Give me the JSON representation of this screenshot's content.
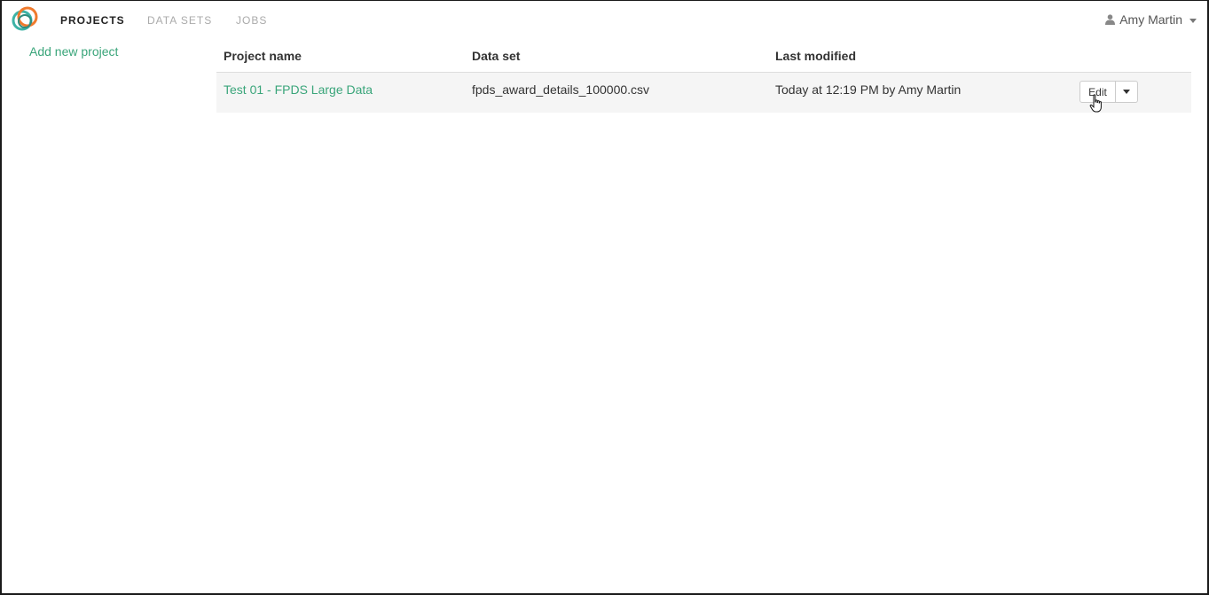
{
  "nav": {
    "items": [
      {
        "label": "PROJECTS",
        "active": true
      },
      {
        "label": "DATA SETS",
        "active": false
      },
      {
        "label": "JOBS",
        "active": false
      }
    ],
    "user_name": "Amy Martin",
    "user_icon": "user-icon"
  },
  "sidebar": {
    "add_project_label": "Add new project"
  },
  "table": {
    "headers": [
      "Project name",
      "Data set",
      "Last modified"
    ],
    "rows": [
      {
        "project_name": "Test 01 - FPDS Large Data",
        "data_set": "fpds_award_details_100000.csv",
        "last_modified": "Today at 12:19 PM by Amy Martin",
        "edit_label": "Edit"
      }
    ]
  },
  "colors": {
    "accent": "#3aa57a",
    "logo_teal": "#3db3a6",
    "logo_orange": "#f07a2c",
    "row_background": "#f5f5f5"
  }
}
